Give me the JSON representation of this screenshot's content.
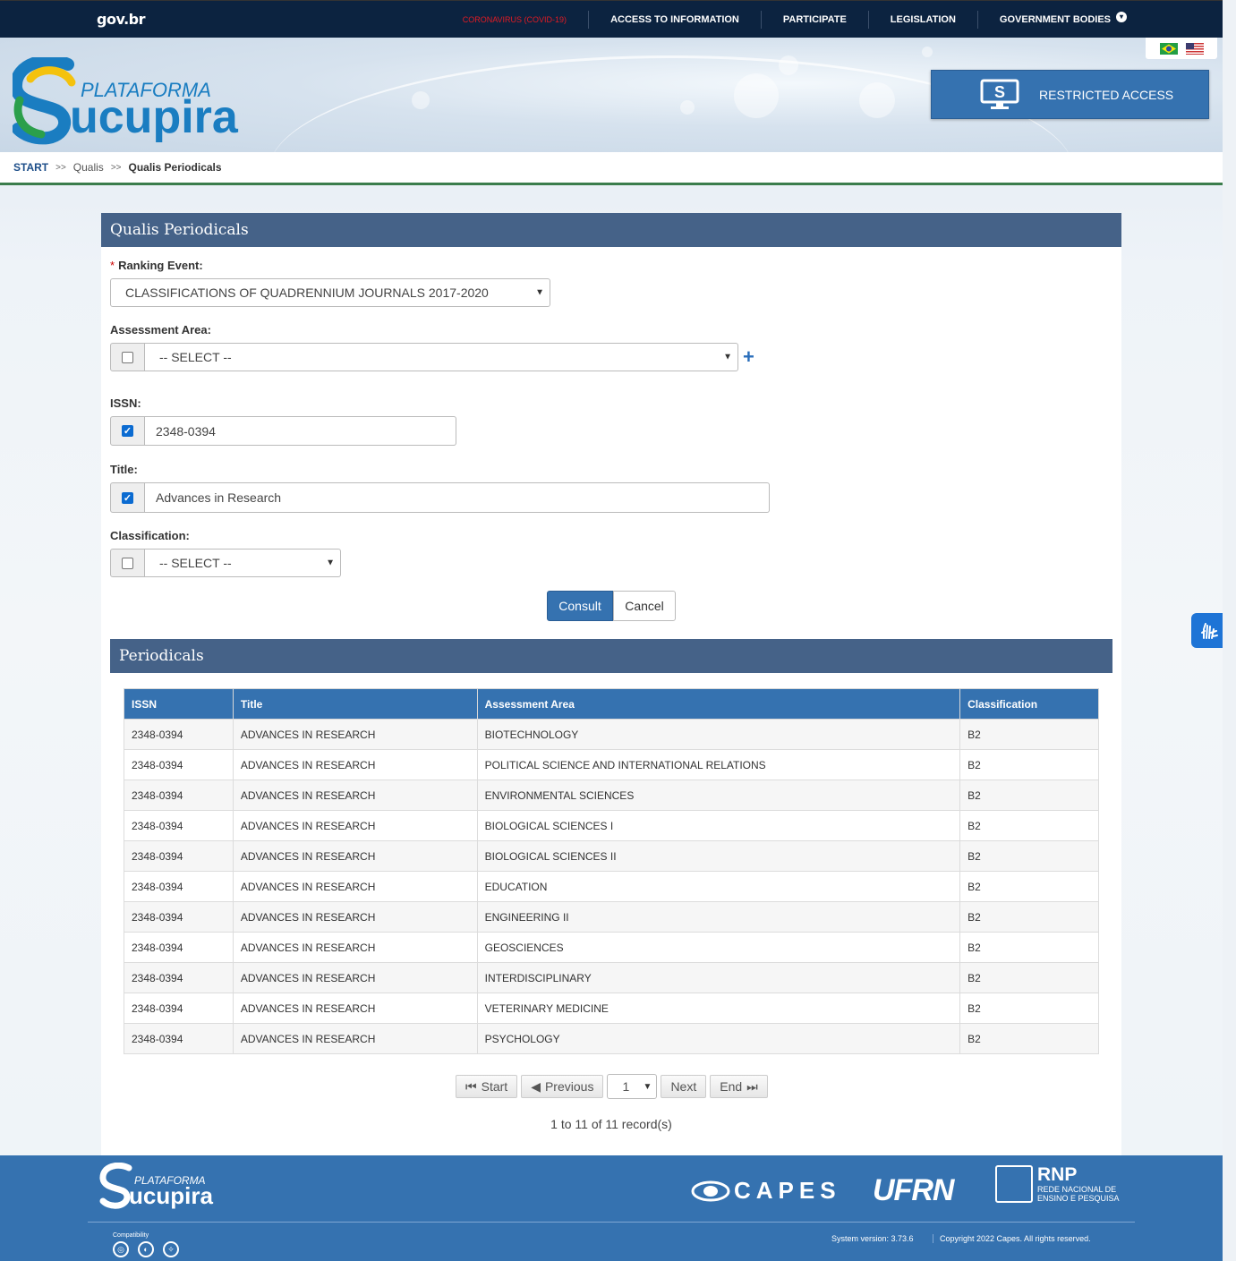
{
  "topbar": {
    "brand": "gov.br",
    "nav": [
      "CORONAVIRUS (COVID-19)",
      "ACCESS TO INFORMATION",
      "PARTICIPATE",
      "LEGISLATION",
      "GOVERNMENT BODIES"
    ]
  },
  "header": {
    "logo_top": "PLATAFORMA",
    "logo_bottom": "ucupira",
    "restricted_label": "RESTRICTED ACCESS"
  },
  "breadcrumb": {
    "start": "START",
    "level1": "Qualis",
    "current": "Qualis Periodicals",
    "separator": ">>"
  },
  "form": {
    "title": "Qualis Periodicals",
    "ranking_event_label": "Ranking Event:",
    "ranking_event_value": "CLASSIFICATIONS OF QUADRENNIUM JOURNALS 2017-2020",
    "assessment_area_label": "Assessment Area:",
    "assessment_area_value": "-- SELECT --",
    "issn_label": "ISSN:",
    "issn_value": "2348-0394",
    "title_label": "Title:",
    "title_value": "Advances in Research",
    "classification_label": "Classification:",
    "classification_value": "-- SELECT --",
    "consult_label": "Consult",
    "cancel_label": "Cancel"
  },
  "results": {
    "title": "Periodicals",
    "columns": [
      "ISSN",
      "Title",
      "Assessment Area",
      "Classification"
    ],
    "rows": [
      [
        "2348-0394",
        "ADVANCES IN RESEARCH",
        "BIOTECHNOLOGY",
        "B2"
      ],
      [
        "2348-0394",
        "ADVANCES IN RESEARCH",
        "POLITICAL SCIENCE AND INTERNATIONAL RELATIONS",
        "B2"
      ],
      [
        "2348-0394",
        "ADVANCES IN RESEARCH",
        "ENVIRONMENTAL SCIENCES",
        "B2"
      ],
      [
        "2348-0394",
        "ADVANCES IN RESEARCH",
        "BIOLOGICAL SCIENCES I",
        "B2"
      ],
      [
        "2348-0394",
        "ADVANCES IN RESEARCH",
        "BIOLOGICAL SCIENCES II",
        "B2"
      ],
      [
        "2348-0394",
        "ADVANCES IN RESEARCH",
        "EDUCATION",
        "B2"
      ],
      [
        "2348-0394",
        "ADVANCES IN RESEARCH",
        "ENGINEERING II",
        "B2"
      ],
      [
        "2348-0394",
        "ADVANCES IN RESEARCH",
        "GEOSCIENCES",
        "B2"
      ],
      [
        "2348-0394",
        "ADVANCES IN RESEARCH",
        "INTERDISCIPLINARY",
        "B2"
      ],
      [
        "2348-0394",
        "ADVANCES IN RESEARCH",
        "VETERINARY MEDICINE",
        "B2"
      ],
      [
        "2348-0394",
        "ADVANCES IN RESEARCH",
        "PSYCHOLOGY",
        "B2"
      ]
    ],
    "pager": {
      "start": "Start",
      "previous": "Previous",
      "page": "1",
      "next": "Next",
      "end": "End"
    },
    "records": "1 to 11 of 11 record(s)"
  },
  "footer": {
    "logo_top": "PLATAFORMA",
    "logo_bottom": "ucupira",
    "capes": "CAPES",
    "ufrn": "UFRN",
    "rnp": "RNP",
    "rnp_sub1": "REDE NACIONAL DE",
    "rnp_sub2": "ENSINO E PESQUISA",
    "compat": "Compatibility",
    "version": "System version: 3.73.6",
    "copyright": "Copyright 2022 Capes. All rights reserved."
  },
  "colors": {
    "navy": "#0c2340",
    "brand_blue": "#3572b0",
    "panel_head": "#456288",
    "accent_green": "#3b7d4c",
    "covid_red": "#e21b23"
  },
  "icons": [
    "chevron-down-icon",
    "brazil-flag-icon",
    "usa-flag-icon",
    "monitor-s-icon",
    "plus-icon",
    "first-page-icon",
    "previous-icon",
    "next-icon",
    "last-page-icon",
    "sign-language-icon",
    "chrome-icon",
    "firefox-icon",
    "safari-icon"
  ]
}
